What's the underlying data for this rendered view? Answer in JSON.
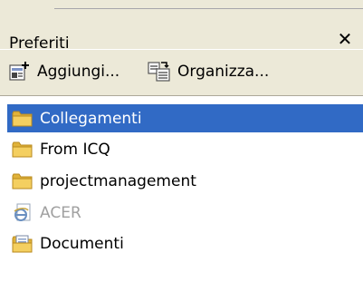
{
  "panel": {
    "title": "Preferiti",
    "close_label": "✕"
  },
  "toolbar": {
    "add_label": "Aggiungi...",
    "organize_label": "Organizza..."
  },
  "favorites": [
    {
      "label": "Collegamenti",
      "icon": "folder-icon",
      "selected": true
    },
    {
      "label": "From ICQ",
      "icon": "folder-icon",
      "selected": false
    },
    {
      "label": "projectmanagement",
      "icon": "folder-icon",
      "selected": false
    },
    {
      "label": "ACER",
      "icon": "ie-page-icon",
      "selected": false,
      "disabled": true
    },
    {
      "label": "Documenti",
      "icon": "special-folder-icon",
      "selected": false
    }
  ],
  "colors": {
    "selection": "#316ac5",
    "toolbar_bg": "#ece9d8",
    "folder": "#f4cf60"
  }
}
